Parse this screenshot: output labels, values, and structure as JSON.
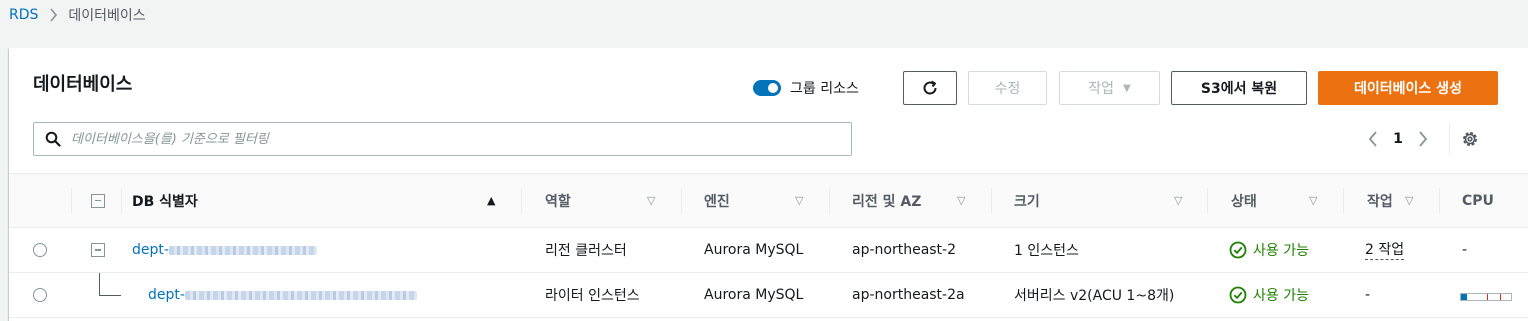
{
  "breadcrumb": {
    "root": "RDS",
    "current": "데이터베이스"
  },
  "panel": {
    "title": "데이터베이스",
    "group_toggle_label": "그룹 리소스",
    "buttons": {
      "modify": "수정",
      "actions": "작업",
      "restore_s3": "S3에서 복원",
      "create": "데이터베이스 생성"
    },
    "search_placeholder": "데이터베이스을(를) 기준으로 필터링",
    "pagination": {
      "page": "1"
    }
  },
  "table": {
    "columns": [
      "DB 식별자",
      "역할",
      "엔진",
      "리전 및 AZ",
      "크기",
      "상태",
      "작업",
      "CPU"
    ],
    "rows": [
      {
        "identifier": "dept-",
        "role": "리전 클러스터",
        "engine": "Aurora MySQL",
        "region": "ap-northeast-2",
        "size": "1 인스턴스",
        "status": "사용 가능",
        "actions": "2 작업",
        "cpu": "-"
      },
      {
        "identifier": "dept-",
        "role": "라이터 인스턴스",
        "engine": "Aurora MySQL",
        "region": "ap-northeast-2a",
        "size": "서버리스 v2(ACU 1~8개)",
        "status": "사용 가능",
        "actions": "-"
      }
    ]
  },
  "colors": {
    "primary": "#ec7211",
    "link": "#0073bb",
    "success": "#1d8102"
  },
  "icons": [
    "chevron-right-icon",
    "refresh-icon",
    "caret-down-icon",
    "search-icon",
    "chevron-left-icon",
    "gear-icon",
    "sort-asc-icon",
    "sort-desc-icon",
    "check-circle-icon",
    "collapse-icon"
  ]
}
